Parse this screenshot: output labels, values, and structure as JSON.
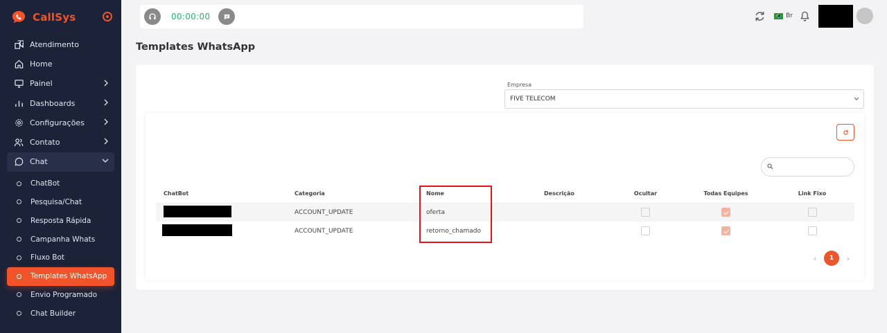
{
  "brand": {
    "name": "CallSys",
    "accent": "#f0542a"
  },
  "sidebar": {
    "items": [
      {
        "label": "Atendimento",
        "icon": "puzzle-icon"
      },
      {
        "label": "Home",
        "icon": "home-icon"
      },
      {
        "label": "Painel",
        "icon": "monitor-icon"
      },
      {
        "label": "Dashboards",
        "icon": "bar-chart-icon"
      },
      {
        "label": "Configurações",
        "icon": "gear-icon"
      },
      {
        "label": "Contato",
        "icon": "users-icon"
      },
      {
        "label": "Chat",
        "icon": "chat-bubble-icon"
      }
    ],
    "chat_sub": [
      {
        "label": "ChatBot"
      },
      {
        "label": "Pesquisa/Chat"
      },
      {
        "label": "Resposta Rápida"
      },
      {
        "label": "Campanha Whats"
      },
      {
        "label": "Fluxo Bot"
      },
      {
        "label": "Templates WhatsApp",
        "active": true
      },
      {
        "label": "Envio Programado"
      },
      {
        "label": "Chat Builder"
      }
    ]
  },
  "topbar": {
    "timer": "00:00:00",
    "language": "Br"
  },
  "page": {
    "title": "Templates WhatsApp"
  },
  "filter": {
    "label": "Empresa",
    "value": "FIVE TELECOM"
  },
  "table": {
    "headers": [
      "ChatBot",
      "Categoria",
      "Nome",
      "Descrição",
      "Ocultar",
      "Todas Equipes",
      "Link Fixo"
    ],
    "rows": [
      {
        "chatbot": "",
        "categoria": "ACCOUNT_UPDATE",
        "nome": "oferta",
        "descricao": "",
        "ocultar": false,
        "todas_equipes": true,
        "link_fixo": false
      },
      {
        "chatbot": "",
        "categoria": "ACCOUNT_UPDATE",
        "nome": "retorno_chamado",
        "descricao": "",
        "ocultar": false,
        "todas_equipes": true,
        "link_fixo": false
      }
    ]
  },
  "pagination": {
    "current": "1"
  },
  "colors": {
    "accent": "#f0542a",
    "sidebar_bg": "#1c2238",
    "timer": "#26b56c",
    "highlight": "#e5141c"
  }
}
